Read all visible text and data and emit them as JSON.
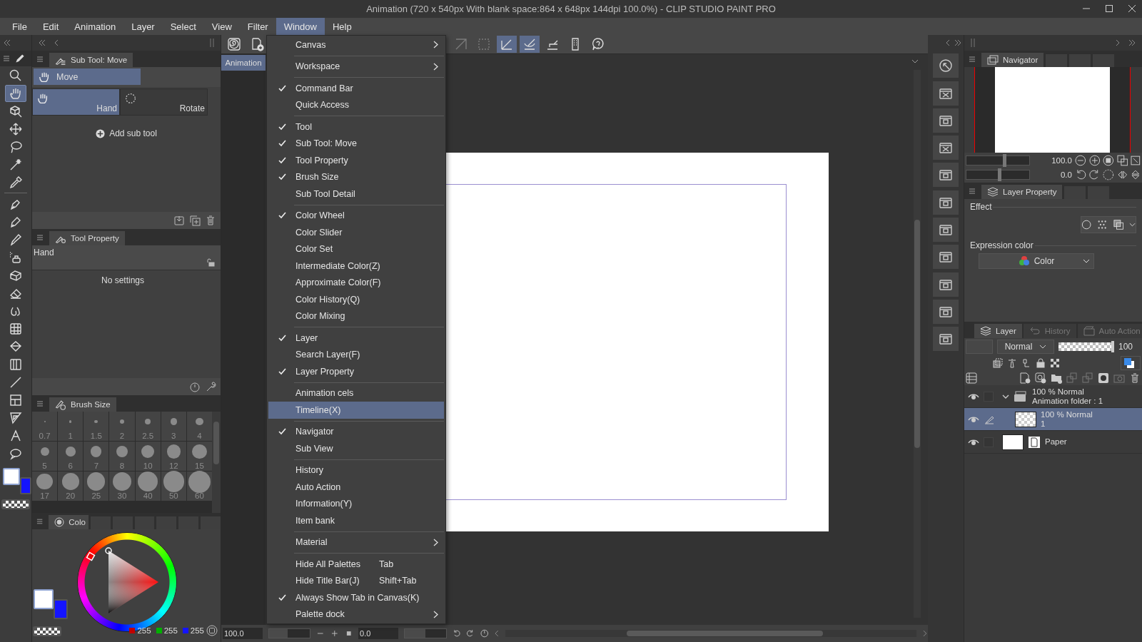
{
  "window": {
    "title": "Animation (720 x 540px With blank space:864 x 648px 144dpi 100.0%) - CLIP STUDIO PAINT PRO"
  },
  "menu_bar": [
    {
      "label": "File",
      "selected": false
    },
    {
      "label": "Edit",
      "selected": false
    },
    {
      "label": "Animation",
      "selected": false
    },
    {
      "label": "Layer",
      "selected": false
    },
    {
      "label": "Select",
      "selected": false
    },
    {
      "label": "View",
      "selected": false
    },
    {
      "label": "Filter",
      "selected": false
    },
    {
      "label": "Window",
      "selected": true
    },
    {
      "label": "Help",
      "selected": false
    }
  ],
  "window_menu": {
    "groups": [
      [
        {
          "label": "Canvas",
          "checked": false,
          "submenu": true,
          "selected": false
        }
      ],
      [
        {
          "label": "Workspace",
          "checked": false,
          "submenu": true,
          "selected": false
        }
      ],
      [
        {
          "label": "Command Bar",
          "checked": true,
          "submenu": false,
          "selected": false
        },
        {
          "label": "Quick Access",
          "checked": false,
          "submenu": false,
          "selected": false
        }
      ],
      [
        {
          "label": "Tool",
          "checked": true,
          "submenu": false,
          "selected": false
        },
        {
          "label": "Sub Tool: Move",
          "checked": true,
          "submenu": false,
          "selected": false
        },
        {
          "label": "Tool Property",
          "checked": true,
          "submenu": false,
          "selected": false
        },
        {
          "label": "Brush Size",
          "checked": true,
          "submenu": false,
          "selected": false
        },
        {
          "label": "Sub Tool Detail",
          "checked": false,
          "submenu": false,
          "selected": false
        }
      ],
      [
        {
          "label": "Color Wheel",
          "checked": true,
          "submenu": false,
          "selected": false
        },
        {
          "label": "Color Slider",
          "checked": false,
          "submenu": false,
          "selected": false
        },
        {
          "label": "Color Set",
          "checked": false,
          "submenu": false,
          "selected": false
        },
        {
          "label": "Intermediate Color(Z)",
          "checked": false,
          "submenu": false,
          "selected": false
        },
        {
          "label": "Approximate Color(F)",
          "checked": false,
          "submenu": false,
          "selected": false
        },
        {
          "label": "Color History(Q)",
          "checked": false,
          "submenu": false,
          "selected": false
        },
        {
          "label": "Color Mixing",
          "checked": false,
          "submenu": false,
          "selected": false
        }
      ],
      [
        {
          "label": "Layer",
          "checked": true,
          "submenu": false,
          "selected": false
        },
        {
          "label": "Search Layer(F)",
          "checked": false,
          "submenu": false,
          "selected": false
        },
        {
          "label": "Layer Property",
          "checked": true,
          "submenu": false,
          "selected": false
        }
      ],
      [
        {
          "label": "Animation cels",
          "checked": false,
          "submenu": false,
          "selected": false
        },
        {
          "label": "Timeline(X)",
          "checked": false,
          "submenu": false,
          "selected": true
        }
      ],
      [
        {
          "label": "Navigator",
          "checked": true,
          "submenu": false,
          "selected": false
        },
        {
          "label": "Sub View",
          "checked": false,
          "submenu": false,
          "selected": false
        }
      ],
      [
        {
          "label": "History",
          "checked": false,
          "submenu": false,
          "selected": false
        },
        {
          "label": "Auto Action",
          "checked": false,
          "submenu": false,
          "selected": false
        },
        {
          "label": "Information(Y)",
          "checked": false,
          "submenu": false,
          "selected": false
        },
        {
          "label": "Item bank",
          "checked": false,
          "submenu": false,
          "selected": false
        }
      ],
      [
        {
          "label": "Material",
          "checked": false,
          "submenu": true,
          "selected": false
        }
      ],
      [
        {
          "label": "Hide All Palettes",
          "shortcut": "Tab",
          "checked": false,
          "submenu": false,
          "selected": false
        },
        {
          "label": "Hide Title Bar(J)",
          "shortcut": "Shift+Tab",
          "checked": false,
          "submenu": false,
          "selected": false
        },
        {
          "label": "Always Show Tab in Canvas(K)",
          "checked": true,
          "submenu": false,
          "selected": false
        },
        {
          "label": "Palette dock",
          "checked": false,
          "submenu": true,
          "selected": false
        }
      ]
    ]
  },
  "tools": [
    {
      "selected": false
    },
    {
      "selected": true
    },
    {
      "selected": false
    },
    {
      "selected": false
    },
    {
      "selected": false
    },
    {
      "selected": false
    },
    {
      "selected": false
    },
    {
      "selected": false
    },
    {
      "selected": false
    },
    {
      "selected": false
    },
    {
      "selected": false
    },
    {
      "selected": false
    },
    {
      "selected": false
    },
    {
      "selected": false
    },
    {
      "selected": false
    },
    {
      "selected": false
    },
    {
      "selected": false
    },
    {
      "selected": false
    },
    {
      "selected": false
    },
    {
      "selected": false
    },
    {
      "selected": false
    },
    {
      "selected": false
    }
  ],
  "toolbar_swatches": [
    {
      "color": "#ffffff",
      "selected": true
    },
    {
      "color": "#1414ff",
      "selected": false
    }
  ],
  "sub_tool_panel": {
    "tab": "Sub Tool: Move",
    "groups": [
      {
        "label": "Move",
        "selected": true
      }
    ],
    "sub_tools": [
      {
        "label": "Hand",
        "selected": true
      },
      {
        "label": "Rotate",
        "selected": false
      }
    ],
    "add_label": "Add sub tool"
  },
  "tool_property": {
    "tab": "Tool Property",
    "tool_name": "Hand",
    "message": "No settings"
  },
  "brush_size": {
    "tab": "Brush Size",
    "sizes": [
      "0.7",
      "1",
      "1.5",
      "2",
      "2.5",
      "3",
      "4",
      "5",
      "6",
      "7",
      "8",
      "10",
      "12",
      "15",
      "17",
      "20",
      "25",
      "30",
      "40",
      "50",
      "60"
    ]
  },
  "color_panel": {
    "tab": "Colo",
    "swatches": [
      {
        "color": "#ffffff",
        "selected": true
      },
      {
        "color": "#1414ff",
        "selected": false
      }
    ],
    "values": [
      {
        "value": "255",
        "color": "#c00000"
      },
      {
        "value": "255",
        "color": "#00b000"
      },
      {
        "value": "255",
        "color": "#1414ff"
      }
    ]
  },
  "command_bar": {
    "tab": "Animation",
    "left_buttons": [
      {
        "selected": false,
        "disabled": false
      },
      {
        "selected": false,
        "disabled": false
      }
    ],
    "right_buttons": [
      {
        "selected": false,
        "disabled": true
      },
      {
        "selected": false,
        "disabled": true
      },
      {
        "selected": true,
        "disabled": false
      },
      {
        "selected": true,
        "disabled": false
      },
      {
        "selected": false,
        "disabled": false
      },
      {
        "selected": false,
        "disabled": false
      },
      {
        "selected": false,
        "disabled": false
      }
    ]
  },
  "canvas_status": {
    "zoom": {
      "reading": "100.0",
      "level": 0.45
    },
    "rotation": {
      "reading": "0.0",
      "level": 0.5
    }
  },
  "navigator": {
    "tab": "Navigator",
    "zoom": {
      "reading": "100.0",
      "level": 0.6
    },
    "rotation": {
      "reading": "0.0",
      "level": 0.52
    }
  },
  "layer_property": {
    "tab": "Layer Property",
    "effect_label": "Effect",
    "expression_label": "Expression color",
    "expression_value": "Color"
  },
  "layer_panel": {
    "tabs": [
      {
        "label": "Layer",
        "selected": true
      },
      {
        "label": "History",
        "selected": false
      },
      {
        "label": "Auto Action",
        "selected": false
      }
    ],
    "blend_mode": "Normal",
    "opacity": {
      "reading": "100",
      "level": 1
    },
    "layers": [
      {
        "kind": "folder",
        "mode": "100 % Normal",
        "name": "Animation folder : 1",
        "expanded": true,
        "selected": false,
        "children": [
          {
            "kind": "raster",
            "mode": "100 % Normal",
            "name": "1",
            "selected": true
          }
        ]
      },
      {
        "kind": "paper",
        "name": "Paper",
        "selected": false
      }
    ]
  }
}
